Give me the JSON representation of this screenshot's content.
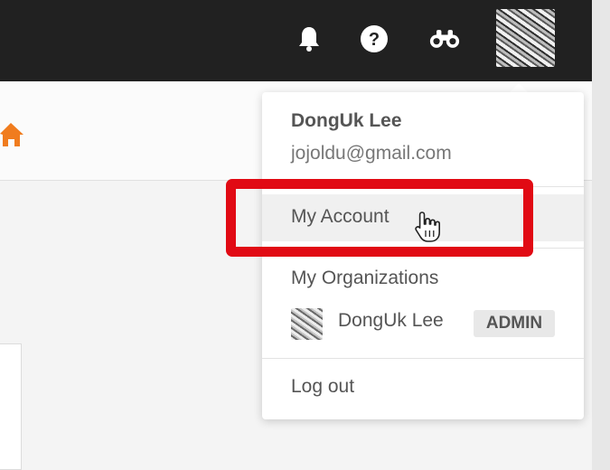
{
  "topbar": {
    "icons": [
      "bell-icon",
      "help-icon",
      "binoculars-icon",
      "avatar"
    ],
    "background": "#212121"
  },
  "dropdown": {
    "user_name": "DongUk Lee",
    "user_email": "jojoldu@gmail.com",
    "my_account_label": "My Account",
    "organizations_header": "My Organizations",
    "organizations": [
      {
        "name": "DongUk Lee",
        "badge": "ADMIN"
      }
    ],
    "logout_label": "Log out"
  },
  "colors": {
    "home_icon": "#f07c1e",
    "highlight": "#e10a14"
  }
}
